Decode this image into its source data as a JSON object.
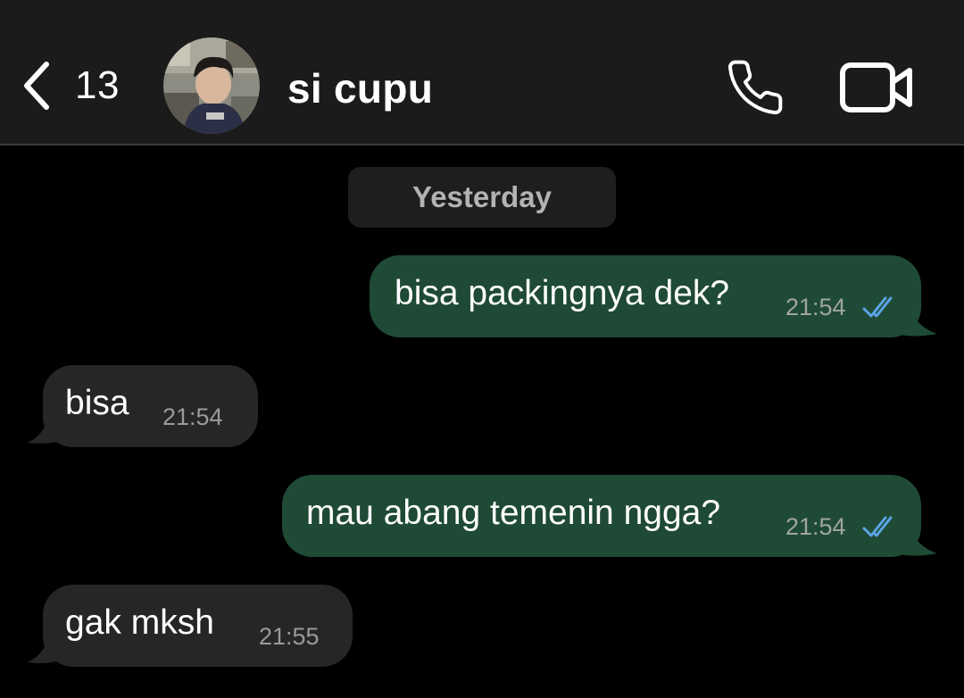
{
  "header": {
    "back_count": "13",
    "contact_name": "si cupu",
    "icons": {
      "back": "chevron-left-icon",
      "call": "phone-icon",
      "video": "video-camera-icon"
    }
  },
  "date_separator": "Yesterday",
  "messages": [
    {
      "direction": "outgoing",
      "text": "bisa packingnya dek?",
      "time": "21:54",
      "status": "read"
    },
    {
      "direction": "incoming",
      "text": "bisa",
      "time": "21:54"
    },
    {
      "direction": "outgoing",
      "text": "mau abang temenin ngga?",
      "time": "21:54",
      "status": "read"
    },
    {
      "direction": "incoming",
      "text": "gak mksh",
      "time": "21:55"
    }
  ],
  "colors": {
    "background": "#000000",
    "header": "#1b1b1b",
    "outgoing_bubble": "#1f4a35",
    "incoming_bubble": "#262626",
    "read_ticks": "#5aa5e6",
    "timestamp": "#a0a5a2"
  }
}
